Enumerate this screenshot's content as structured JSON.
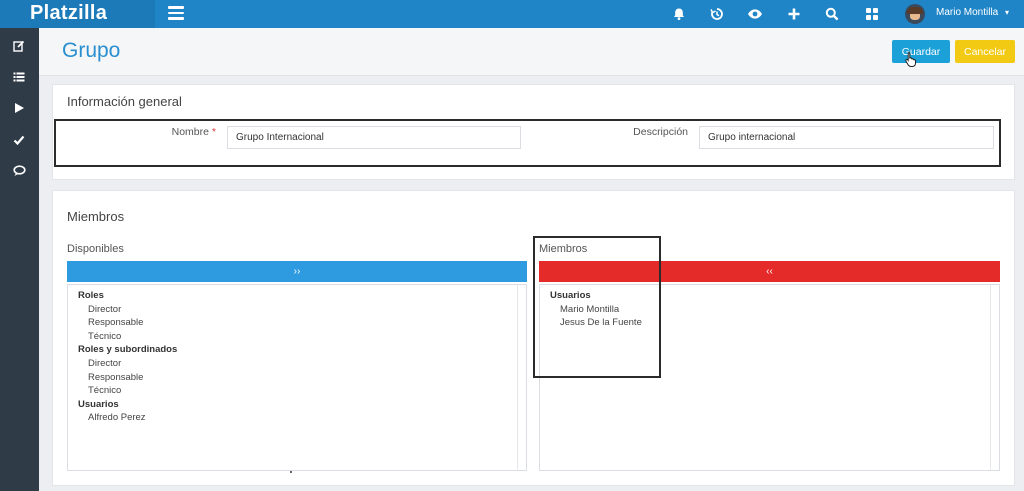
{
  "app": {
    "brand": "Platzilla",
    "user_name": "Mario Montilla"
  },
  "topbar_icons": [
    "bell-icon",
    "history-icon",
    "eye-icon",
    "plus-icon",
    "search-icon",
    "grid-icon"
  ],
  "sidebar_icons": [
    "edit-icon",
    "list-icon",
    "play-icon",
    "check-icon",
    "chat-icon"
  ],
  "page": {
    "title": "Grupo",
    "save_label": "Guardar",
    "cancel_label": "Cancelar"
  },
  "info": {
    "heading": "Información general",
    "name_label": "Nombre",
    "required_mark": "*",
    "name_value": "Grupo Internacional",
    "description_label": "Descripción",
    "description_value": "Grupo internacional"
  },
  "members": {
    "heading": "Miembros",
    "available_label": "Disponibles",
    "selected_label": "Miembros",
    "move_right": "››",
    "move_left": "‹‹",
    "available": [
      {
        "group": "Roles",
        "items": [
          "Director",
          "Responsable",
          "Técnico"
        ]
      },
      {
        "group": "Roles y subordinados",
        "items": [
          "Director",
          "Responsable",
          "Técnico"
        ]
      },
      {
        "group": "Usuarios",
        "items": [
          "Alfredo Perez"
        ]
      }
    ],
    "selected": [
      {
        "group": "Usuarios",
        "items": [
          "Mario Montilla",
          "Jesus De la Fuente"
        ]
      }
    ]
  },
  "colors": {
    "topbar": "#1f85c7",
    "sidebar": "#2f3b47",
    "save": "#1ba0d8",
    "cancel": "#f2c913",
    "move_right": "#2e9be0",
    "move_left": "#e52a2a",
    "title": "#2a8fd0"
  }
}
